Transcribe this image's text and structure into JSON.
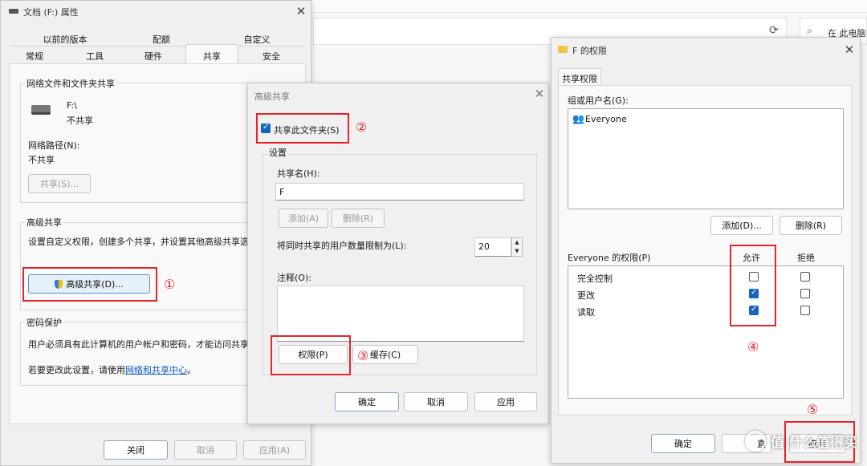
{
  "props": {
    "title": "文档 (F:) 属性",
    "tabs_row1": [
      "以前的版本",
      "配额",
      "自定义"
    ],
    "tabs_row2": [
      "常规",
      "工具",
      "硬件",
      "共享",
      "安全"
    ],
    "net_section": "网络文件和文件夹共享",
    "drive_name": "F:\\",
    "drive_status": "不共享",
    "net_path_label": "网络路径(N):",
    "net_path_value": "不共享",
    "share_btn": "共享(S)...",
    "adv_section": "高级共享",
    "adv_desc": "设置自定义权限，创建多个共享，并设置其他高级共享选",
    "adv_btn": "高级共享(D)...",
    "pwd_section": "密码保护",
    "pwd_desc": "用户必须具有此计算机的用户帐户和密码，才能访问共享",
    "pwd_change_pre": "若要更改此设置，请使用",
    "pwd_link": "网络和共享中心",
    "pwd_change_post": "。",
    "ok": "关闭",
    "cancel": "取消",
    "apply": "应用(A)"
  },
  "adv": {
    "title": "高级共享",
    "share_checkbox": "共享此文件夹(S)",
    "settings": "设置",
    "share_name_label": "共享名(H):",
    "share_name_value": "F",
    "add": "添加(A)",
    "remove": "删除(R)",
    "limit_label": "将同时共享的用户数量限制为(L):",
    "limit_value": "20",
    "comment_label": "注释(O):",
    "perm_btn": "权限(P)",
    "cache_btn": "缓存(C)",
    "ok": "确定",
    "cancel": "取消",
    "apply": "应用"
  },
  "perm": {
    "title": "F 的权限",
    "tab": "共享权限",
    "users_label": "组或用户名(G):",
    "user": "Everyone",
    "add": "添加(D)...",
    "remove": "删除(R)",
    "perms_label": "Everyone 的权限(P)",
    "allow": "允许",
    "deny": "拒绝",
    "rows": [
      {
        "name": "完全控制",
        "allow": false,
        "deny": false
      },
      {
        "name": "更改",
        "allow": true,
        "deny": false
      },
      {
        "name": "读取",
        "allow": true,
        "deny": false
      }
    ],
    "ok": "确定",
    "cancel_partial": "直",
    "apply_partial": "应用"
  },
  "explorer": {
    "search": "在 此电脑"
  },
  "markers": [
    "①",
    "②",
    "③",
    "④",
    "⑤"
  ],
  "watermark": "值 什么值得买",
  "colors": {
    "highlight": "#e8242a",
    "link": "#0a58ca",
    "check": "#1565c0"
  }
}
